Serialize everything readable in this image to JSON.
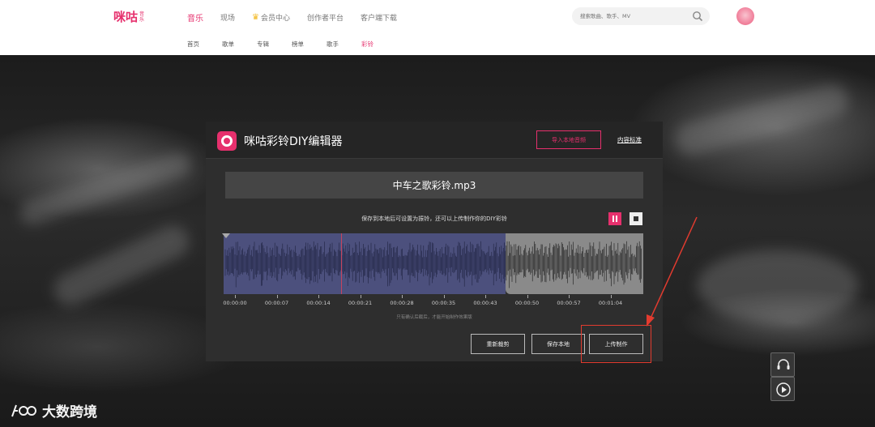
{
  "header": {
    "logo_text": "咪咕",
    "logo_sub": "音乐",
    "nav": [
      "音乐",
      "现场",
      "会员中心",
      "创作者平台",
      "客户端下载"
    ],
    "subnav": [
      "首页",
      "歌单",
      "专辑",
      "榜单",
      "歌手",
      "彩铃"
    ],
    "search_placeholder": "搜索歌曲、歌手、MV"
  },
  "editor": {
    "title": "咪咕彩铃DIY编辑器",
    "import_label": "导入本地音频",
    "content_standard_label": "内容标准",
    "filename": "中车之歌彩铃.mp3",
    "hint": "保存到本地后可设置为振铃，还可以上传制作你的DIY彩铃",
    "note": "只有确认后截后，才能开始制作效果版",
    "time_ticks": [
      "00:00:00",
      "00:00:07",
      "00:00:14",
      "00:00:21",
      "00:00:28",
      "00:00:35",
      "00:00:43",
      "00:00:50",
      "00:00:57",
      "00:01:04"
    ],
    "buttons": {
      "recut": "重新裁剪",
      "save_local": "保存本地",
      "upload": "上传制作"
    }
  },
  "watermark": "大数跨境",
  "colors": {
    "accent": "#e6306d",
    "selection": "#4c507d",
    "annotation": "#e23b2f"
  }
}
